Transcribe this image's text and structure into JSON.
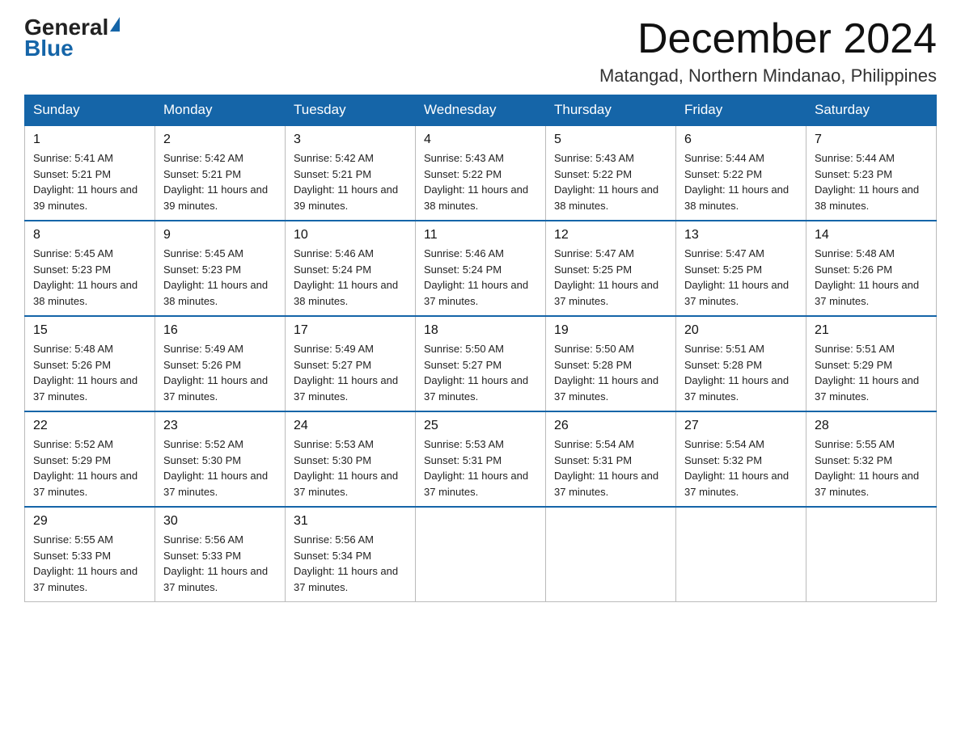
{
  "logo": {
    "general": "General",
    "triangle": "",
    "blue": "Blue"
  },
  "header": {
    "month_year": "December 2024",
    "location": "Matangad, Northern Mindanao, Philippines"
  },
  "weekdays": [
    "Sunday",
    "Monday",
    "Tuesday",
    "Wednesday",
    "Thursday",
    "Friday",
    "Saturday"
  ],
  "weeks": [
    [
      {
        "day": "1",
        "sunrise": "Sunrise: 5:41 AM",
        "sunset": "Sunset: 5:21 PM",
        "daylight": "Daylight: 11 hours and 39 minutes."
      },
      {
        "day": "2",
        "sunrise": "Sunrise: 5:42 AM",
        "sunset": "Sunset: 5:21 PM",
        "daylight": "Daylight: 11 hours and 39 minutes."
      },
      {
        "day": "3",
        "sunrise": "Sunrise: 5:42 AM",
        "sunset": "Sunset: 5:21 PM",
        "daylight": "Daylight: 11 hours and 39 minutes."
      },
      {
        "day": "4",
        "sunrise": "Sunrise: 5:43 AM",
        "sunset": "Sunset: 5:22 PM",
        "daylight": "Daylight: 11 hours and 38 minutes."
      },
      {
        "day": "5",
        "sunrise": "Sunrise: 5:43 AM",
        "sunset": "Sunset: 5:22 PM",
        "daylight": "Daylight: 11 hours and 38 minutes."
      },
      {
        "day": "6",
        "sunrise": "Sunrise: 5:44 AM",
        "sunset": "Sunset: 5:22 PM",
        "daylight": "Daylight: 11 hours and 38 minutes."
      },
      {
        "day": "7",
        "sunrise": "Sunrise: 5:44 AM",
        "sunset": "Sunset: 5:23 PM",
        "daylight": "Daylight: 11 hours and 38 minutes."
      }
    ],
    [
      {
        "day": "8",
        "sunrise": "Sunrise: 5:45 AM",
        "sunset": "Sunset: 5:23 PM",
        "daylight": "Daylight: 11 hours and 38 minutes."
      },
      {
        "day": "9",
        "sunrise": "Sunrise: 5:45 AM",
        "sunset": "Sunset: 5:23 PM",
        "daylight": "Daylight: 11 hours and 38 minutes."
      },
      {
        "day": "10",
        "sunrise": "Sunrise: 5:46 AM",
        "sunset": "Sunset: 5:24 PM",
        "daylight": "Daylight: 11 hours and 38 minutes."
      },
      {
        "day": "11",
        "sunrise": "Sunrise: 5:46 AM",
        "sunset": "Sunset: 5:24 PM",
        "daylight": "Daylight: 11 hours and 37 minutes."
      },
      {
        "day": "12",
        "sunrise": "Sunrise: 5:47 AM",
        "sunset": "Sunset: 5:25 PM",
        "daylight": "Daylight: 11 hours and 37 minutes."
      },
      {
        "day": "13",
        "sunrise": "Sunrise: 5:47 AM",
        "sunset": "Sunset: 5:25 PM",
        "daylight": "Daylight: 11 hours and 37 minutes."
      },
      {
        "day": "14",
        "sunrise": "Sunrise: 5:48 AM",
        "sunset": "Sunset: 5:26 PM",
        "daylight": "Daylight: 11 hours and 37 minutes."
      }
    ],
    [
      {
        "day": "15",
        "sunrise": "Sunrise: 5:48 AM",
        "sunset": "Sunset: 5:26 PM",
        "daylight": "Daylight: 11 hours and 37 minutes."
      },
      {
        "day": "16",
        "sunrise": "Sunrise: 5:49 AM",
        "sunset": "Sunset: 5:26 PM",
        "daylight": "Daylight: 11 hours and 37 minutes."
      },
      {
        "day": "17",
        "sunrise": "Sunrise: 5:49 AM",
        "sunset": "Sunset: 5:27 PM",
        "daylight": "Daylight: 11 hours and 37 minutes."
      },
      {
        "day": "18",
        "sunrise": "Sunrise: 5:50 AM",
        "sunset": "Sunset: 5:27 PM",
        "daylight": "Daylight: 11 hours and 37 minutes."
      },
      {
        "day": "19",
        "sunrise": "Sunrise: 5:50 AM",
        "sunset": "Sunset: 5:28 PM",
        "daylight": "Daylight: 11 hours and 37 minutes."
      },
      {
        "day": "20",
        "sunrise": "Sunrise: 5:51 AM",
        "sunset": "Sunset: 5:28 PM",
        "daylight": "Daylight: 11 hours and 37 minutes."
      },
      {
        "day": "21",
        "sunrise": "Sunrise: 5:51 AM",
        "sunset": "Sunset: 5:29 PM",
        "daylight": "Daylight: 11 hours and 37 minutes."
      }
    ],
    [
      {
        "day": "22",
        "sunrise": "Sunrise: 5:52 AM",
        "sunset": "Sunset: 5:29 PM",
        "daylight": "Daylight: 11 hours and 37 minutes."
      },
      {
        "day": "23",
        "sunrise": "Sunrise: 5:52 AM",
        "sunset": "Sunset: 5:30 PM",
        "daylight": "Daylight: 11 hours and 37 minutes."
      },
      {
        "day": "24",
        "sunrise": "Sunrise: 5:53 AM",
        "sunset": "Sunset: 5:30 PM",
        "daylight": "Daylight: 11 hours and 37 minutes."
      },
      {
        "day": "25",
        "sunrise": "Sunrise: 5:53 AM",
        "sunset": "Sunset: 5:31 PM",
        "daylight": "Daylight: 11 hours and 37 minutes."
      },
      {
        "day": "26",
        "sunrise": "Sunrise: 5:54 AM",
        "sunset": "Sunset: 5:31 PM",
        "daylight": "Daylight: 11 hours and 37 minutes."
      },
      {
        "day": "27",
        "sunrise": "Sunrise: 5:54 AM",
        "sunset": "Sunset: 5:32 PM",
        "daylight": "Daylight: 11 hours and 37 minutes."
      },
      {
        "day": "28",
        "sunrise": "Sunrise: 5:55 AM",
        "sunset": "Sunset: 5:32 PM",
        "daylight": "Daylight: 11 hours and 37 minutes."
      }
    ],
    [
      {
        "day": "29",
        "sunrise": "Sunrise: 5:55 AM",
        "sunset": "Sunset: 5:33 PM",
        "daylight": "Daylight: 11 hours and 37 minutes."
      },
      {
        "day": "30",
        "sunrise": "Sunrise: 5:56 AM",
        "sunset": "Sunset: 5:33 PM",
        "daylight": "Daylight: 11 hours and 37 minutes."
      },
      {
        "day": "31",
        "sunrise": "Sunrise: 5:56 AM",
        "sunset": "Sunset: 5:34 PM",
        "daylight": "Daylight: 11 hours and 37 minutes."
      },
      null,
      null,
      null,
      null
    ]
  ]
}
